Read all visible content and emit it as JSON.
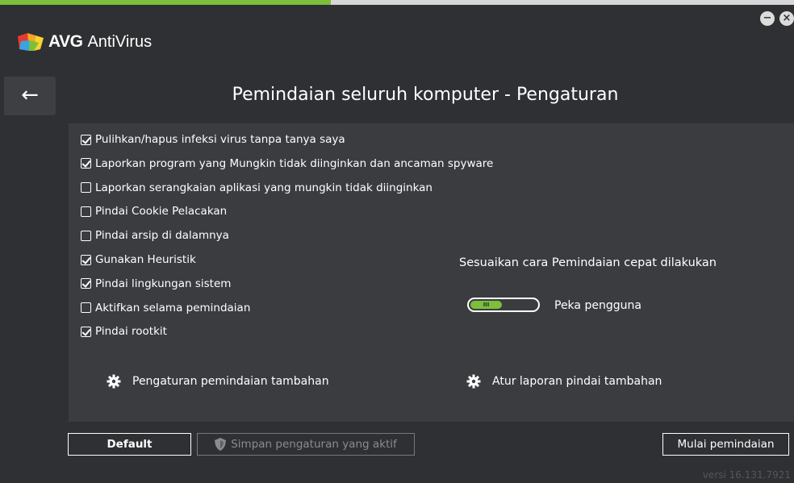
{
  "app": {
    "brand": "AVG",
    "product": "AntiVirus",
    "minimize_glyph": "−",
    "close_glyph": "×",
    "back_glyph": "←"
  },
  "colors": {
    "accent_green": "#7bbf3a",
    "window_bg": "#2f3033",
    "panel_bg": "#3b3c40"
  },
  "page": {
    "title": "Pemindaian seluruh komputer - Pengaturan"
  },
  "options": [
    {
      "label": "Pulihkan/hapus infeksi virus tanpa tanya saya",
      "checked": true
    },
    {
      "label": "Laporkan program yang Mungkin tidak diinginkan dan ancaman spyware",
      "checked": true
    },
    {
      "label": "Laporkan serangkaian aplikasi yang mungkin tidak diinginkan",
      "checked": false
    },
    {
      "label": "Pindai Cookie Pelacakan",
      "checked": false
    },
    {
      "label": "Pindai arsip di dalamnya",
      "checked": false
    },
    {
      "label": "Gunakan Heuristik",
      "checked": true
    },
    {
      "label": "Pindai lingkungan sistem",
      "checked": true
    },
    {
      "label": "Aktifkan selama pemindaian",
      "checked": false
    },
    {
      "label": "Pindai rootkit",
      "checked": true
    }
  ],
  "quick_scan": {
    "heading": "Sesuaikan cara Pemindaian cepat dilakukan",
    "slider_label": "Peka pengguna",
    "slider_grip": "III",
    "slider_level": 0.45
  },
  "links": {
    "additional_scan_settings": "Pengaturan pemindaian tambahan",
    "additional_scan_reports": "Atur laporan pindai tambahan"
  },
  "buttons": {
    "default": "Default",
    "save": "Simpan pengaturan yang aktif",
    "start_scan": "Mulai pemindaian"
  },
  "footer": {
    "version": "versi 16.131.7921"
  },
  "icons": {
    "brand": "avg-logo-icon",
    "back": "arrow-left-icon",
    "gear": "gear-icon",
    "shield": "shield-icon"
  }
}
